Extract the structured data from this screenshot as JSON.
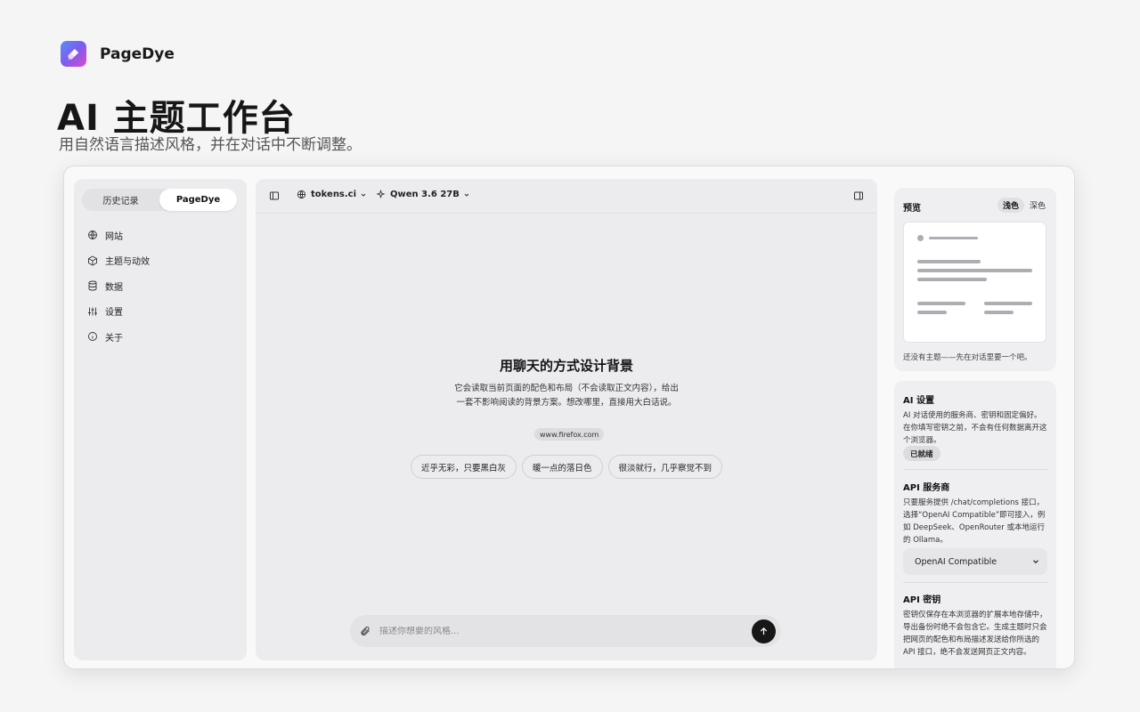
{
  "brand": {
    "name": "PageDye",
    "logo_icon": "brush-icon"
  },
  "hero": {
    "title": "AI 主题工作台",
    "subtitle": "用自然语言描述风格，并在对话中不断调整。"
  },
  "left_panel": {
    "tabs": [
      {
        "label": "历史记录",
        "active": false
      },
      {
        "label": "PageDye",
        "active": true
      }
    ],
    "nav": [
      {
        "label": "网站",
        "icon": "globe-icon"
      },
      {
        "label": "主题与动效",
        "icon": "cube-icon"
      },
      {
        "label": "数据",
        "icon": "database-icon"
      },
      {
        "label": "设置",
        "icon": "sliders-icon"
      },
      {
        "label": "关于",
        "icon": "info-icon"
      }
    ]
  },
  "center_panel": {
    "site_label": "tokens.ci",
    "model_label": "Qwen 3.6 27B",
    "empty_title": "用聊天的方式设计背景",
    "empty_desc": "它会读取当前页面的配色和布局（不会读取正文内容），给出一套不影响阅读的背景方案。想改哪里，直接用大白话说。",
    "url_pill": "www.firefox.com",
    "suggestions": [
      "近乎无彩，只要黑白灰",
      "暖一点的落日色",
      "很淡就行，几乎察觉不到"
    ],
    "composer_placeholder": "描述你想要的风格..."
  },
  "right_panel": {
    "preview": {
      "title": "预览",
      "modes": [
        {
          "label": "浅色",
          "active": true
        },
        {
          "label": "深色",
          "active": false
        }
      ],
      "note": "还没有主题——先在对话里要一个吧。"
    },
    "ai_settings": {
      "title": "AI 设置",
      "body": "AI 对话使用的服务商、密钥和固定偏好。在你填写密钥之前，不会有任何数据离开这个浏览器。",
      "status": "已就绪"
    },
    "provider": {
      "title": "API 服务商",
      "body": "只要服务提供 /chat/completions 接口，选择“OpenAI Compatible”即可接入，例如 DeepSeek、OpenRouter 或本地运行的 Ollama。",
      "selected": "OpenAI Compatible"
    },
    "api_key": {
      "title": "API 密钥",
      "body": "密钥仅保存在本浏览器的扩展本地存储中，导出备份时绝不会包含它。生成主题时只会把网页的配色和布局描述发送给你所选的 API 接口，绝不会发送网页正文内容。"
    }
  }
}
